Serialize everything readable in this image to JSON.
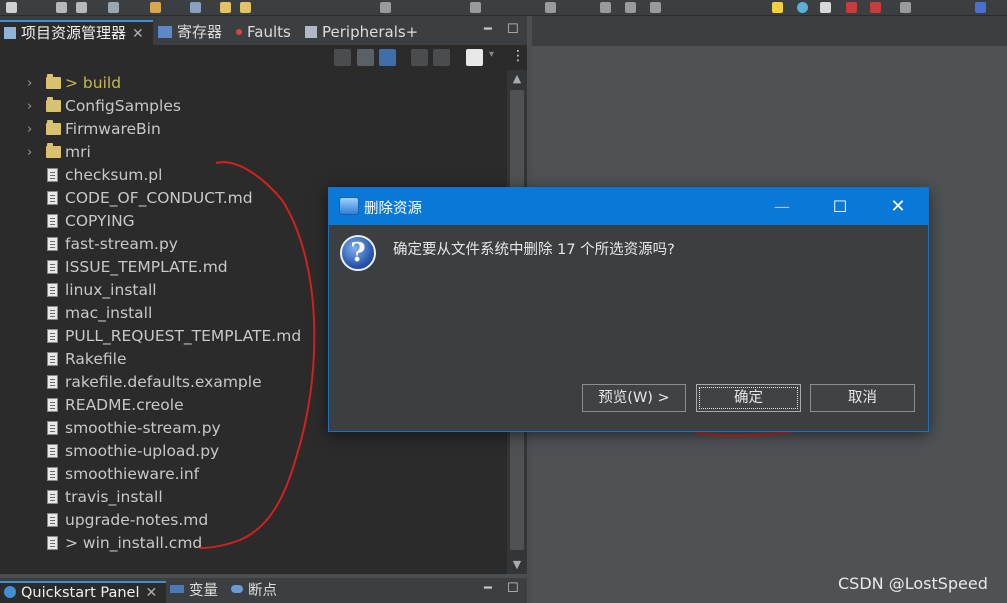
{
  "explorer": {
    "tabs": [
      {
        "label": "项目资源管理器",
        "close": "✕"
      },
      {
        "label": "寄存器"
      },
      {
        "label": "Faults"
      },
      {
        "label": "Peripherals+"
      }
    ],
    "tree": [
      {
        "label": "> build",
        "type": "folder"
      },
      {
        "label": "ConfigSamples",
        "type": "folder"
      },
      {
        "label": "FirmwareBin",
        "type": "folder"
      },
      {
        "label": "mri",
        "type": "folder"
      },
      {
        "label": "checksum.pl",
        "type": "file"
      },
      {
        "label": "CODE_OF_CONDUCT.md",
        "type": "file"
      },
      {
        "label": "COPYING",
        "type": "file"
      },
      {
        "label": "fast-stream.py",
        "type": "file"
      },
      {
        "label": "ISSUE_TEMPLATE.md",
        "type": "file"
      },
      {
        "label": "linux_install",
        "type": "file"
      },
      {
        "label": "mac_install",
        "type": "file"
      },
      {
        "label": "PULL_REQUEST_TEMPLATE.md",
        "type": "file"
      },
      {
        "label": "Rakefile",
        "type": "file"
      },
      {
        "label": "rakefile.defaults.example",
        "type": "file"
      },
      {
        "label": "README.creole",
        "type": "file"
      },
      {
        "label": "smoothie-stream.py",
        "type": "file"
      },
      {
        "label": "smoothie-upload.py",
        "type": "file"
      },
      {
        "label": "smoothieware.inf",
        "type": "file"
      },
      {
        "label": "travis_install",
        "type": "file"
      },
      {
        "label": "upgrade-notes.md",
        "type": "file"
      },
      {
        "label": "> win_install.cmd",
        "type": "file"
      }
    ]
  },
  "bottom_panel": {
    "tabs": [
      {
        "label": "Quickstart Panel",
        "close": "✕"
      },
      {
        "label": "变量"
      },
      {
        "label": "断点"
      }
    ]
  },
  "dialog": {
    "title": "删除资源",
    "message": "确定要从文件系统中删除 17 个所选资源吗?",
    "buttons": {
      "preview": "预览(W) >",
      "ok": "确定",
      "cancel": "取消"
    }
  },
  "watermark": "CSDN @LostSpeed"
}
